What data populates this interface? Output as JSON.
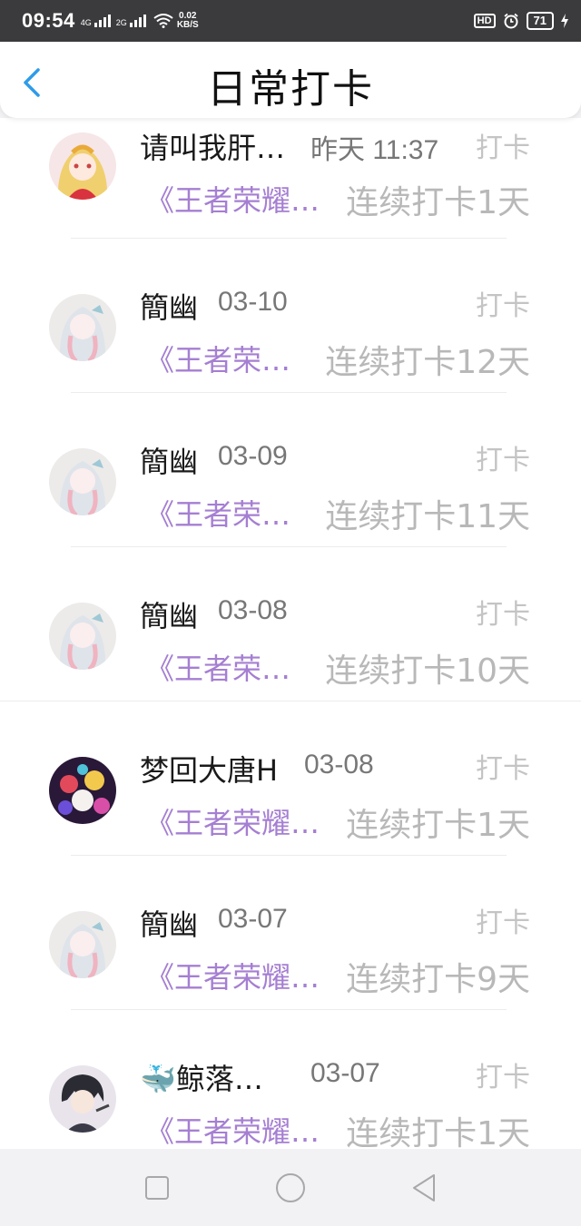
{
  "status_bar": {
    "time": "09:54",
    "net1": "4G",
    "net2": "2G",
    "speed_value": "0.02",
    "speed_unit": "KB/S",
    "hd": "HD",
    "battery": "71"
  },
  "header": {
    "title": "日常打卡"
  },
  "entries": [
    {
      "name": "请叫我肝…",
      "date": "昨天 11:37",
      "action": "打卡",
      "game": "《王者荣耀…",
      "streak": "连续打卡1天",
      "avatar": "anime-blonde-girl"
    },
    {
      "name": "簡幽",
      "date": "03-10",
      "action": "打卡",
      "game": "《王者荣…",
      "streak": "连续打卡12天",
      "avatar": "anime-silver-hair"
    },
    {
      "name": "簡幽",
      "date": "03-09",
      "action": "打卡",
      "game": "《王者荣…",
      "streak": "连续打卡11天",
      "avatar": "anime-silver-hair"
    },
    {
      "name": "簡幽",
      "date": "03-08",
      "action": "打卡",
      "game": "《王者荣…",
      "streak": "连续打卡10天",
      "avatar": "anime-silver-hair"
    },
    {
      "name": "梦回大唐H",
      "date": "03-08",
      "action": "打卡",
      "game": "《王者荣耀…",
      "streak": "连续打卡1天",
      "avatar": "colorful-characters"
    },
    {
      "name": "簡幽",
      "date": "03-07",
      "action": "打卡",
      "game": "《王者荣耀…",
      "streak": "连续打卡9天",
      "avatar": "anime-silver-hair"
    },
    {
      "name": "🐳鲸落…",
      "date": "03-07",
      "action": "打卡",
      "game": "《王者荣耀…",
      "streak": "连续打卡1天",
      "avatar": "anime-dark-hair-boy"
    }
  ],
  "system_nav": {
    "recent_icon": "square-icon",
    "home_icon": "circle-icon",
    "back_icon": "triangle-back-icon"
  },
  "colors": {
    "accent_blue": "#2f9bea",
    "game_purple": "#a57fd2",
    "status_bar_bg": "#3b3b3d"
  }
}
